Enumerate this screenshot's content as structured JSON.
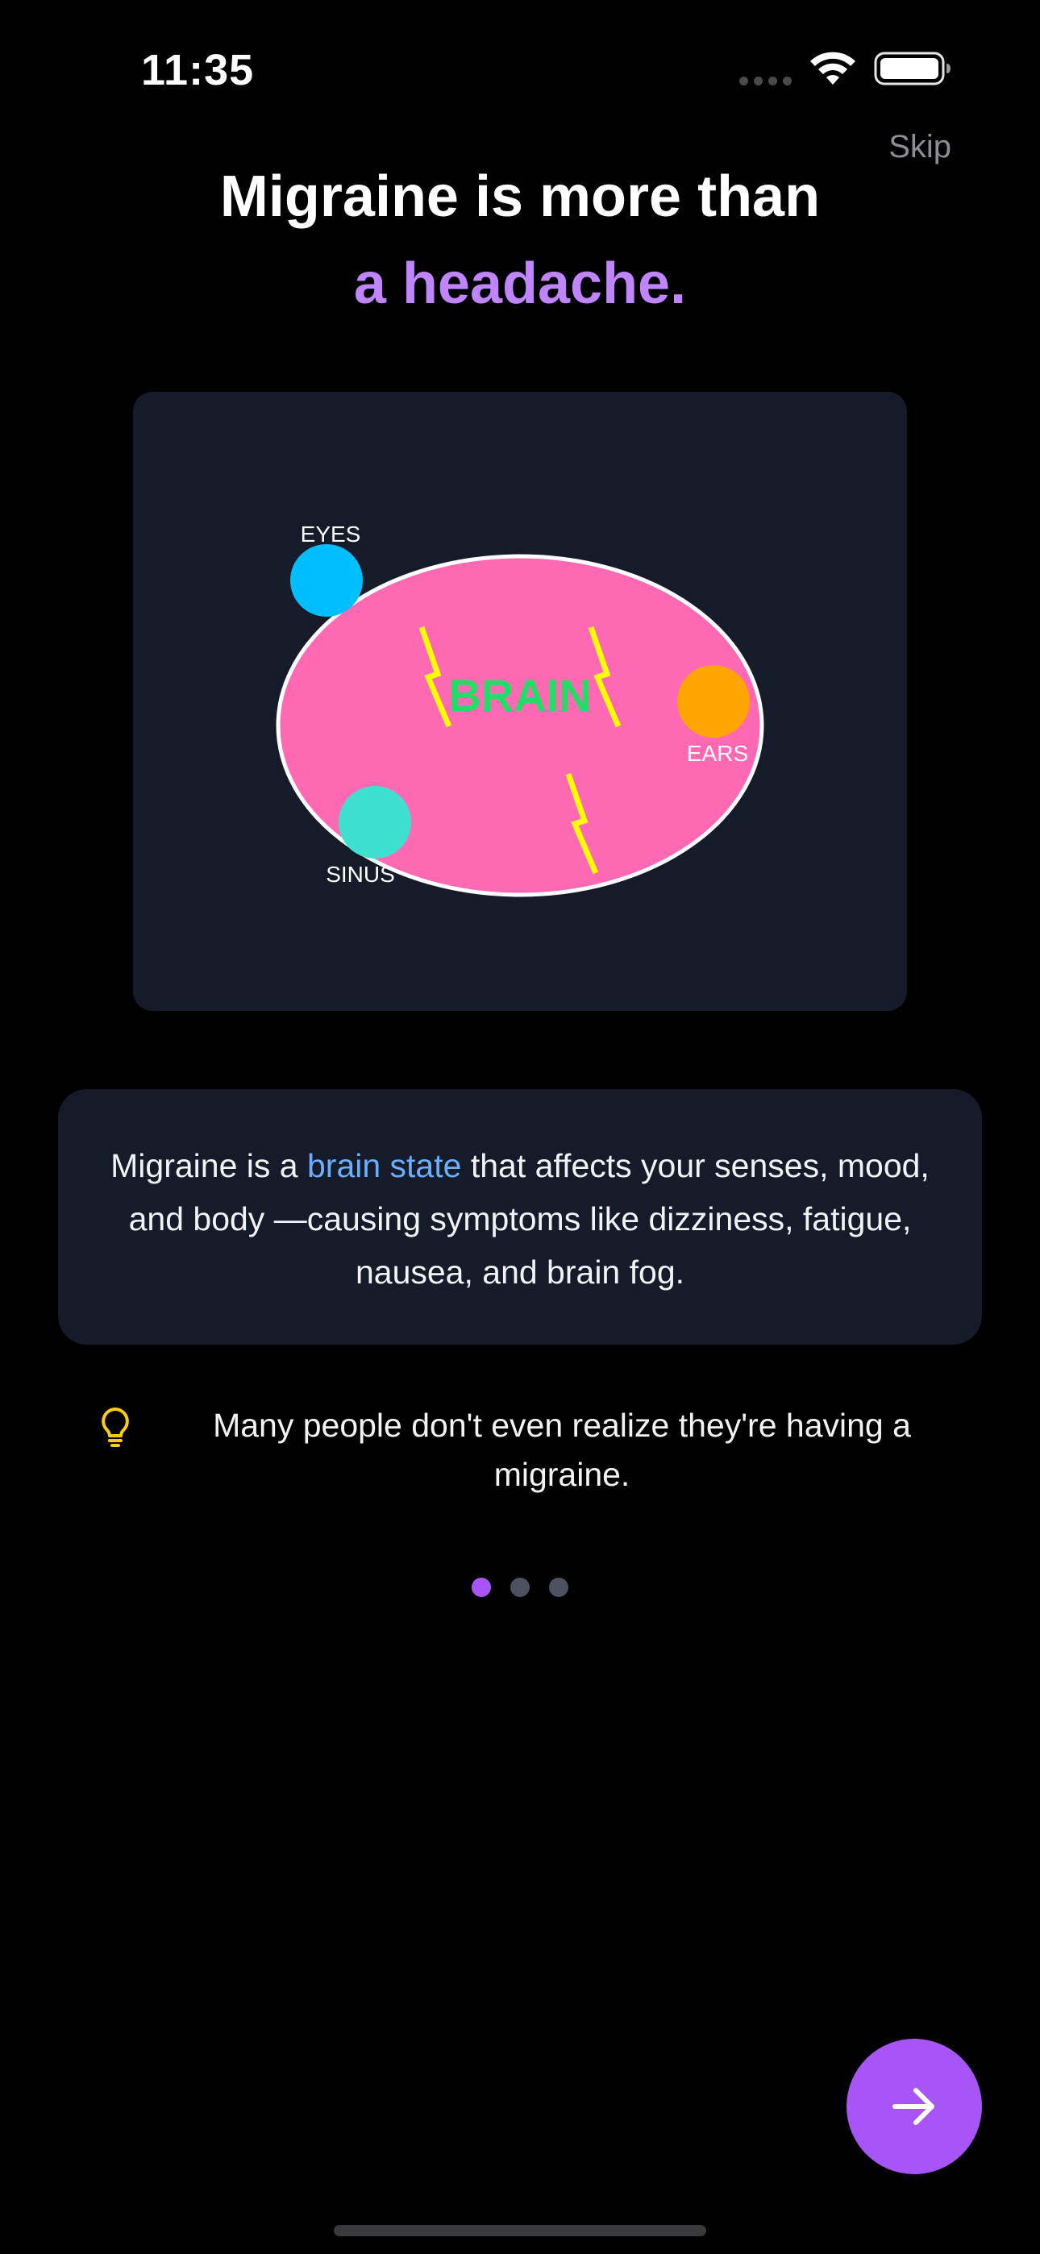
{
  "status_bar": {
    "time": "11:35",
    "icons": [
      "cellular-signal-icon",
      "wifi-icon",
      "battery-icon"
    ]
  },
  "skip_label": "Skip",
  "title": {
    "line1": "Migraine is more than",
    "line2": "a headache."
  },
  "illustration": {
    "brain_label": "BRAIN",
    "labels": {
      "eyes": "EYES",
      "ears": "EARS",
      "sinus": "SINUS"
    },
    "colors": {
      "brain": "#ff69b4",
      "eyes": "#00bfff",
      "ears": "#ffa500",
      "sinus": "#40e0d0",
      "lightning": "#ffff00",
      "brain_text": "#22dd66"
    }
  },
  "info": {
    "part1": "Migraine is a ",
    "highlight": "brain state",
    "part2": " that affects your senses, mood, and body —causing symptoms like dizziness, fatigue, nausea, and brain fog."
  },
  "tip": {
    "icon": "lightbulb-icon",
    "text": "Many people don't even realize they're having a migraine."
  },
  "pagination": {
    "total": 3,
    "current": 1
  },
  "next_button": {
    "icon": "arrow-right-icon"
  },
  "colors": {
    "accent": "#a855f7",
    "title_highlight": "#c084fc",
    "link": "#6aaefc",
    "card_bg": "#151b29",
    "tip_icon": "#facc15"
  }
}
